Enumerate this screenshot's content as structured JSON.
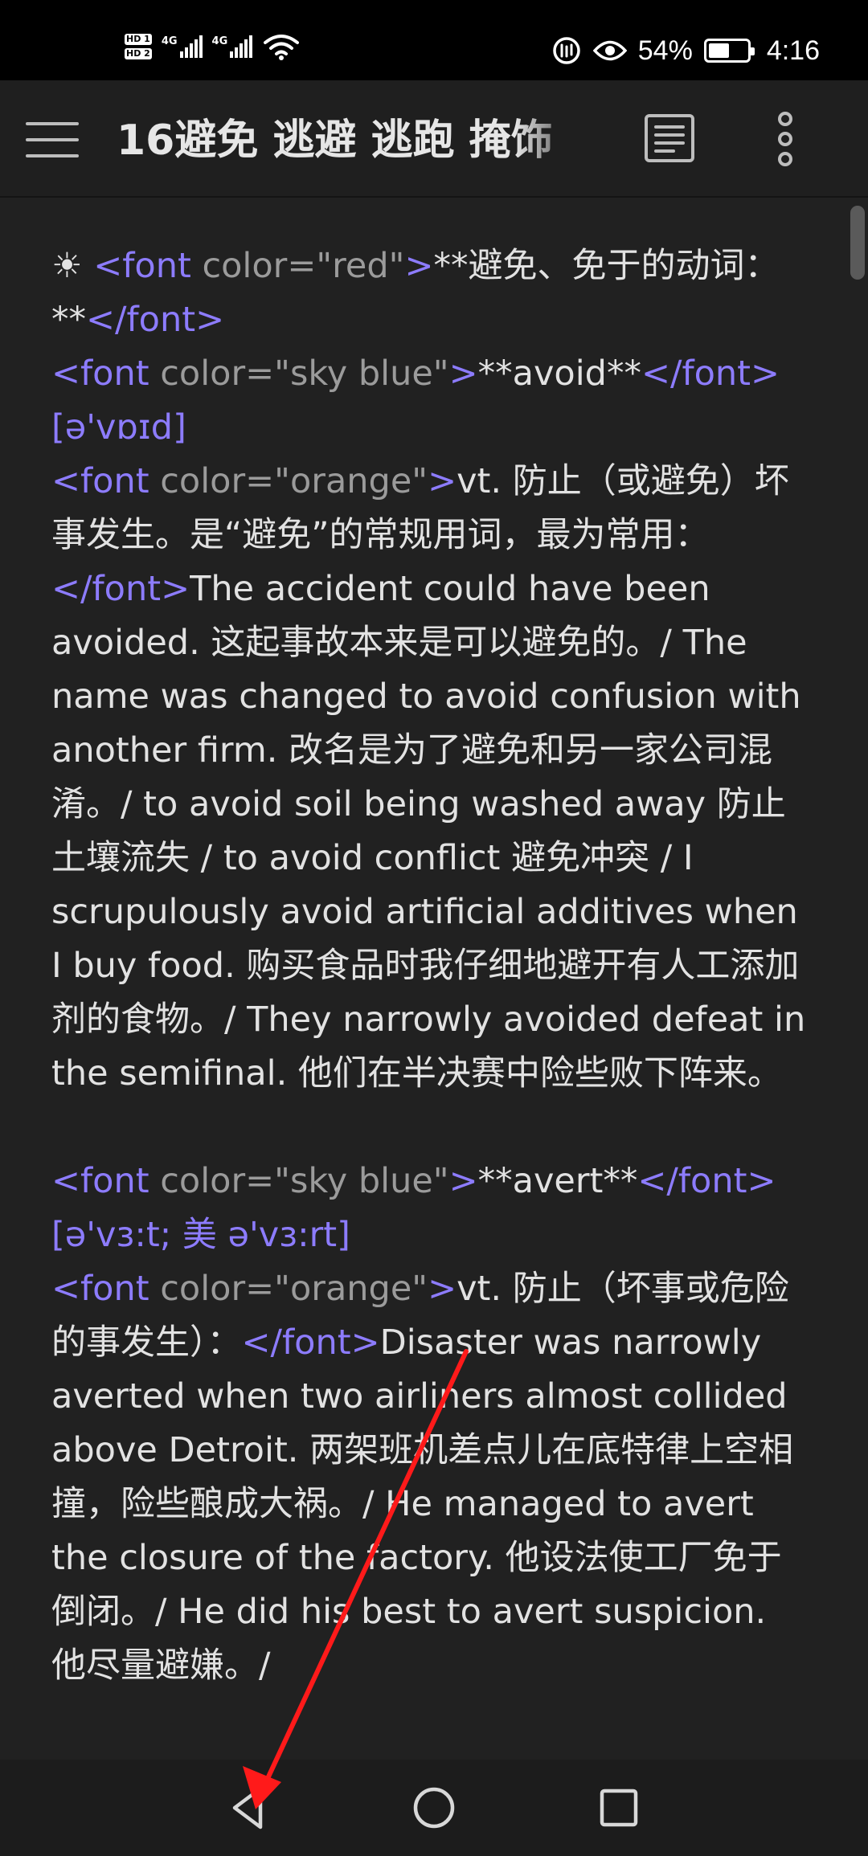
{
  "status_bar": {
    "sim1": "HD 1",
    "sim2": "HD 2",
    "network1": "4G",
    "network2": "4G",
    "battery_percent_text": "54%",
    "battery_level": 0.54,
    "time": "4:16"
  },
  "toolbar": {
    "title": "16避免 逃避 逃跑 掩饰"
  },
  "note": {
    "e1": "☀ ",
    "t1": "<font",
    "a1": " color=\"red\"",
    "t2": ">",
    "e2": "**避免、免于的动词：**",
    "t3": "</font>",
    "t4": "<font",
    "a2": " color=\"sky blue\"",
    "t5": ">",
    "e3": "**avoid**",
    "t6": "</font>",
    "ipa1": "[ə'vɒɪd]",
    "t7": "<font",
    "a3": " color=\"orange\"",
    "t8": ">",
    "e4": "vt. 防止（或避免）坏事发生。是“避免”的常规用词，最为常用：",
    "t9": "</font>",
    "e5": "The accident could have been avoided. 这起事故本来是可以避免的。/ The name was changed to avoid confusion with another firm. 改名是为了避免和另一家公司混淆。/ to avoid soil being washed away 防止土壤流失 / to avoid conflict 避免冲突 / I scrupulously avoid artificial additives when I buy food. 购买食品时我仔细地避开有人工添加剂的食物。/ They narrowly avoided defeat in the semifinal. 他们在半决赛中险些败下阵来。",
    "t10": "<font",
    "a4": " color=\"sky blue\"",
    "t11": ">",
    "e6": "**avert**",
    "t12": "</font>",
    "ipa2": "[ə'vɜ:t; 美 ə'vɜ:rt]",
    "t13": "<font",
    "a5": " color=\"orange\"",
    "t14": ">",
    "e7": "vt. 防止（坏事或危险的事发生）：",
    "t15": "</font>",
    "e8": "Disaster was narrowly averted when two airliners almost collided above Detroit. 两架班机差点儿在底特律上空相撞，险些酿成大祸。/ He managed to avert the closure of the factory. 他设法使工厂免于倒闭。/ He did his best to avert suspicion. 他尽量避嫌。/"
  },
  "colors": {
    "status_bar_bg": "#000000",
    "toolbar_bg": "#1f1f1f",
    "content_bg": "#212121",
    "tag_color": "#8d7cff",
    "attr_color": "#9b9b9b",
    "annotation_arrow": "#ff1a1a"
  },
  "icons": {
    "menu": "hamburger-menu-icon",
    "reader": "reading-mode-icon",
    "more": "more-vertical-icon",
    "back": "back-triangle-icon",
    "home": "home-circle-icon",
    "recents": "recents-square-icon"
  }
}
